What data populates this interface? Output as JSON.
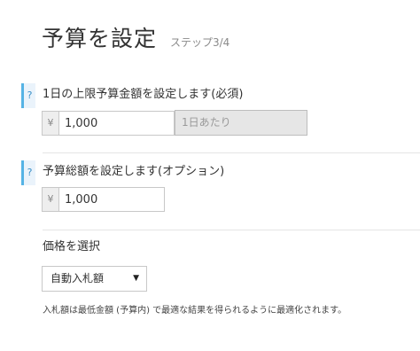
{
  "header": {
    "title": "予算を設定",
    "step": "ステップ3/4"
  },
  "daily_budget": {
    "help_icon": "?",
    "label": "1日の上限予算金額を設定します(必須)",
    "currency_symbol": "¥",
    "value": "1,000",
    "unit_addon": "1日あたり"
  },
  "total_budget": {
    "help_icon": "?",
    "label": "予算総額を設定します(オプション)",
    "currency_symbol": "¥",
    "value": "1,000"
  },
  "pricing": {
    "label": "価格を選択",
    "selected_option": "自動入札額",
    "dropdown_icon": "▼",
    "note": "入札額は最低金額 (予算内) で最適な結果を得られるように最適化されます。"
  },
  "colors": {
    "help_accent": "#55b3e5",
    "addon_background": "#e6e6e6"
  }
}
